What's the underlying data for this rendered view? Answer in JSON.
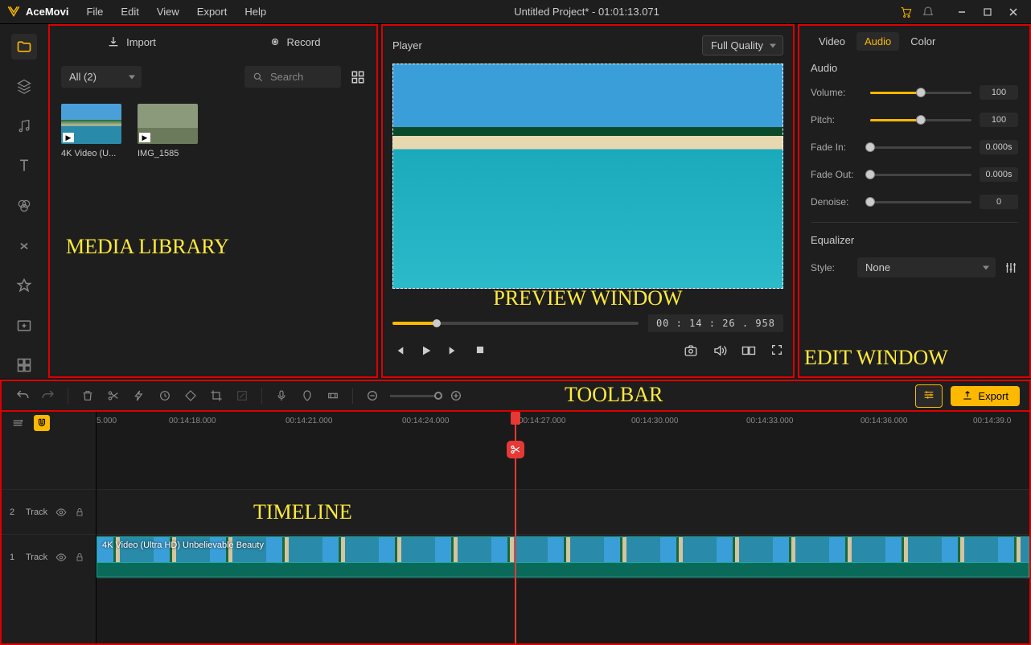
{
  "app": {
    "name": "AceMovi",
    "menus": [
      "File",
      "Edit",
      "View",
      "Export",
      "Help"
    ],
    "title": "Untitled Project* - 01:01:13.071"
  },
  "media": {
    "import_label": "Import",
    "record_label": "Record",
    "filter_label": "All (2)",
    "search_placeholder": "Search",
    "items": [
      {
        "name": "4K Video (U..."
      },
      {
        "name": "IMG_1585"
      }
    ]
  },
  "overlays": {
    "media": "MEDIA LIBRARY",
    "preview": "PREVIEW WINDOW",
    "edit": "EDIT WINDOW",
    "toolbar": "TOOLBAR",
    "timeline": "TIMELINE"
  },
  "player": {
    "title": "Player",
    "quality": "Full Quality",
    "timecode": "00 : 14 : 26 . 958"
  },
  "edit": {
    "tabs": [
      "Video",
      "Audio",
      "Color"
    ],
    "section": "Audio",
    "rows": {
      "volume": {
        "label": "Volume:",
        "value": "100",
        "pct": 50
      },
      "pitch": {
        "label": "Pitch:",
        "value": "100",
        "pct": 50
      },
      "fadein": {
        "label": "Fade In:",
        "value": "0.000s",
        "pct": 0
      },
      "fadeout": {
        "label": "Fade Out:",
        "value": "0.000s",
        "pct": 0
      },
      "denoise": {
        "label": "Denoise:",
        "value": "0",
        "pct": 0
      }
    },
    "equalizer": {
      "title": "Equalizer",
      "style_label": "Style:",
      "style_value": "None"
    }
  },
  "toolbar": {
    "export": "Export"
  },
  "timeline": {
    "ticks": [
      "5.000",
      "00:14:18.000",
      "00:14:21.000",
      "00:14:24.000",
      "00:14:27.000",
      "00:14:30.000",
      "00:14:33.000",
      "00:14:36.000",
      "00:14:39.0"
    ],
    "tracks": [
      {
        "num": "2",
        "label": "Track"
      },
      {
        "num": "1",
        "label": "Track"
      }
    ],
    "clip_title": "4K Video (Ultra HD) Unbelievable Beauty",
    "playhead_pct": 45
  }
}
